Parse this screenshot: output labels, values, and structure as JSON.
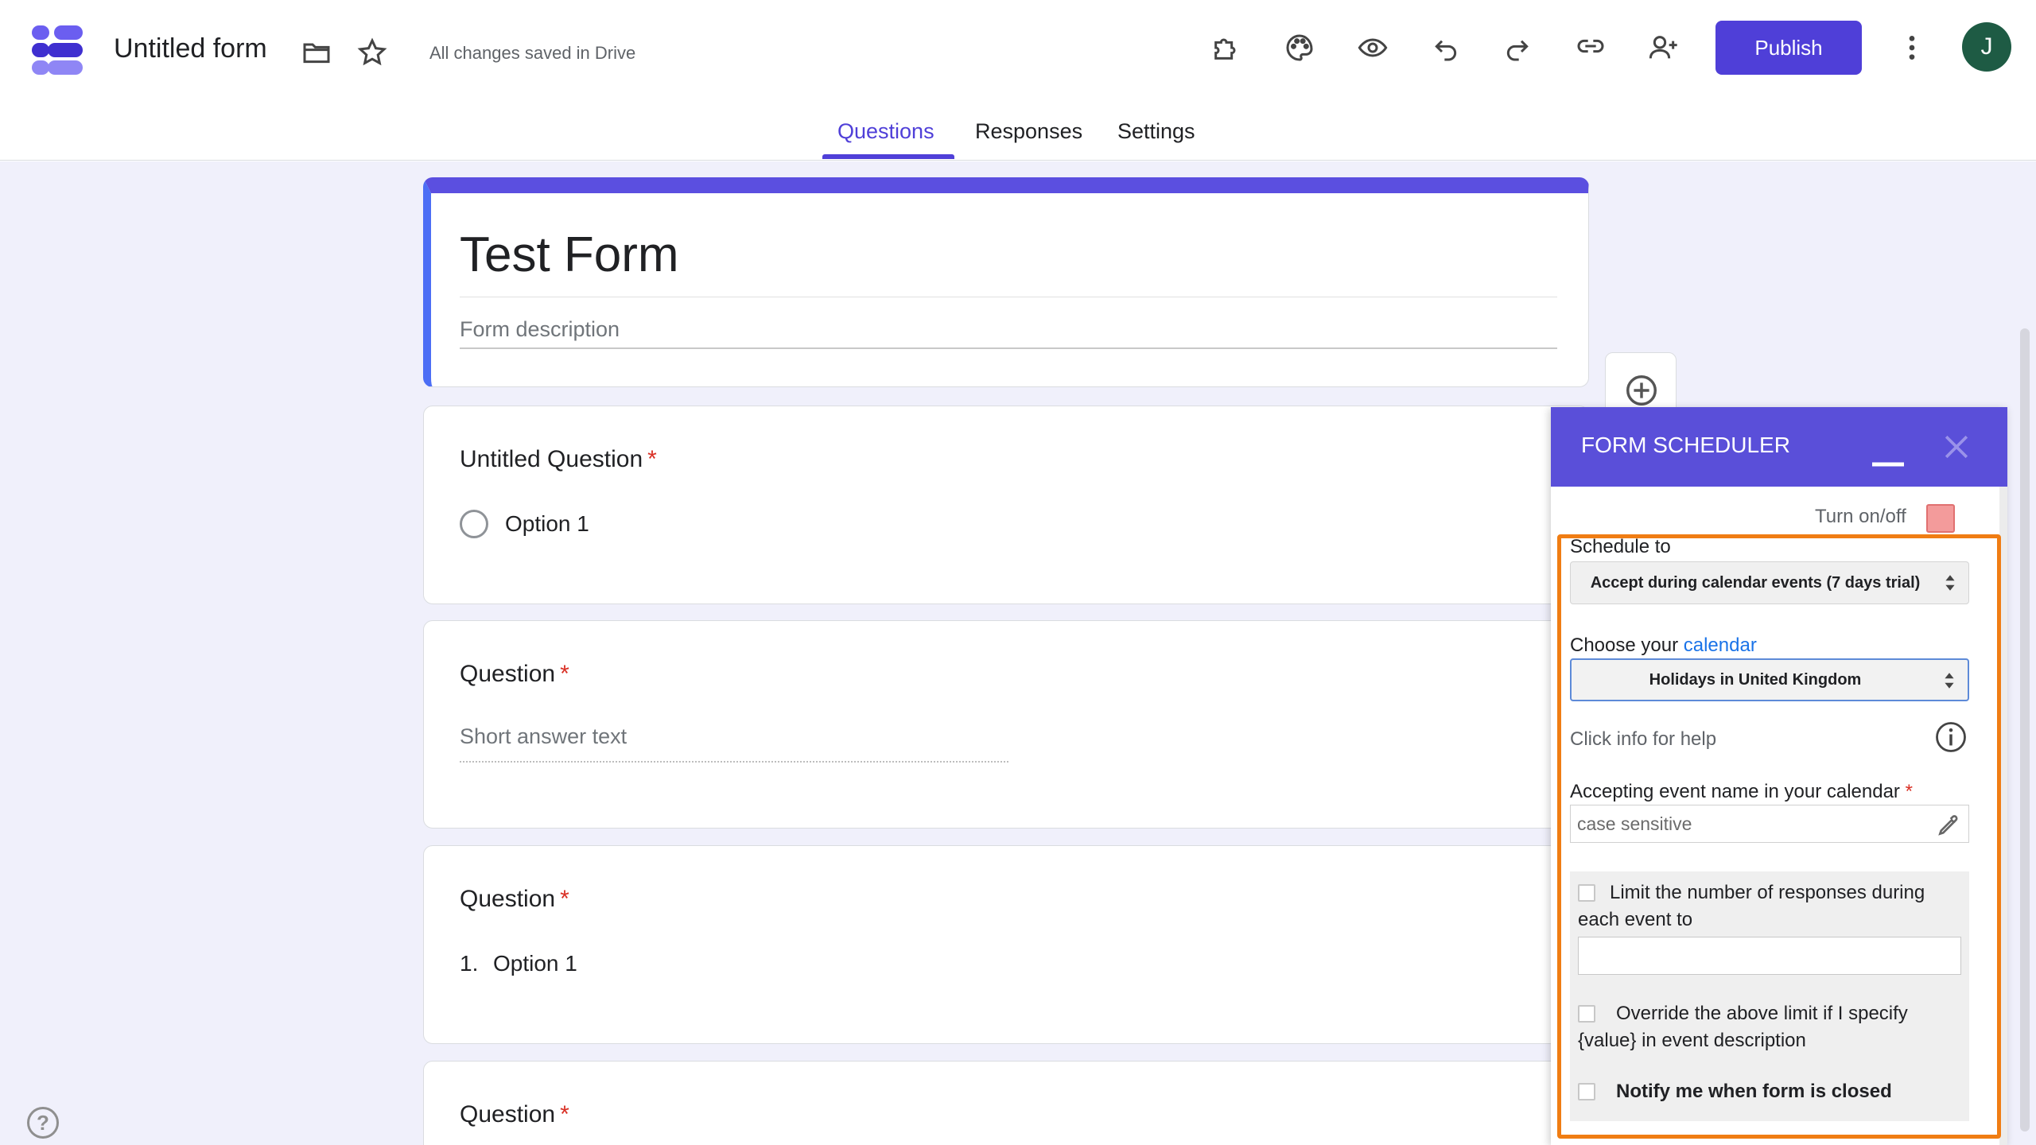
{
  "app": {
    "doc_title": "Untitled form",
    "save_status": "All changes saved in Drive",
    "publish_label": "Publish",
    "avatar_initial": "J",
    "toolbar_icons": [
      "folder-icon",
      "star-icon",
      "addon-puzzle-icon",
      "palette-icon",
      "preview-eye-icon",
      "undo-icon",
      "redo-icon",
      "link-icon",
      "add-collaborator-icon",
      "more-vert-icon"
    ]
  },
  "tabs": [
    {
      "label": "Questions",
      "active": true
    },
    {
      "label": "Responses",
      "active": false
    },
    {
      "label": "Settings",
      "active": false
    }
  ],
  "form": {
    "title": "Test Form",
    "description_placeholder": "Form description"
  },
  "questions": [
    {
      "title": "Untitled Question",
      "required_mark": "*",
      "option": "Option 1"
    },
    {
      "title": "Question",
      "required_mark": "*",
      "placeholder": "Short answer text"
    },
    {
      "title": "Question",
      "required_mark": "*",
      "option_number": "1.",
      "option": "Option 1"
    },
    {
      "title": "Question",
      "required_mark": "*"
    }
  ],
  "side_tools": [
    "add-question-icon",
    "import-questions-icon",
    "title-text-icon",
    "image-icon"
  ],
  "scheduler": {
    "title": "FORM SCHEDULER",
    "turn_label": "Turn on/off",
    "schedule_label": "Schedule to",
    "schedule_value": "Accept during calendar events (7 days trial)",
    "calendar_label_prefix": "Choose your ",
    "calendar_link": "calendar",
    "calendar_value": "Holidays in United Kingdom",
    "help_text": "Click info for help",
    "event_label": "Accepting event name in your calendar",
    "event_required": "*",
    "event_placeholder": "case sensitive",
    "limit_label": "Limit the number of responses during each event to",
    "override_label": "Override the above limit if I specify {value} in event description",
    "notify_label": "Notify me when form is closed"
  },
  "colors": {
    "accent": "#4f3fd8",
    "header_bar": "#5a4fd9",
    "highlight": "#f07d13",
    "toggle_off": "#f39b9b"
  }
}
